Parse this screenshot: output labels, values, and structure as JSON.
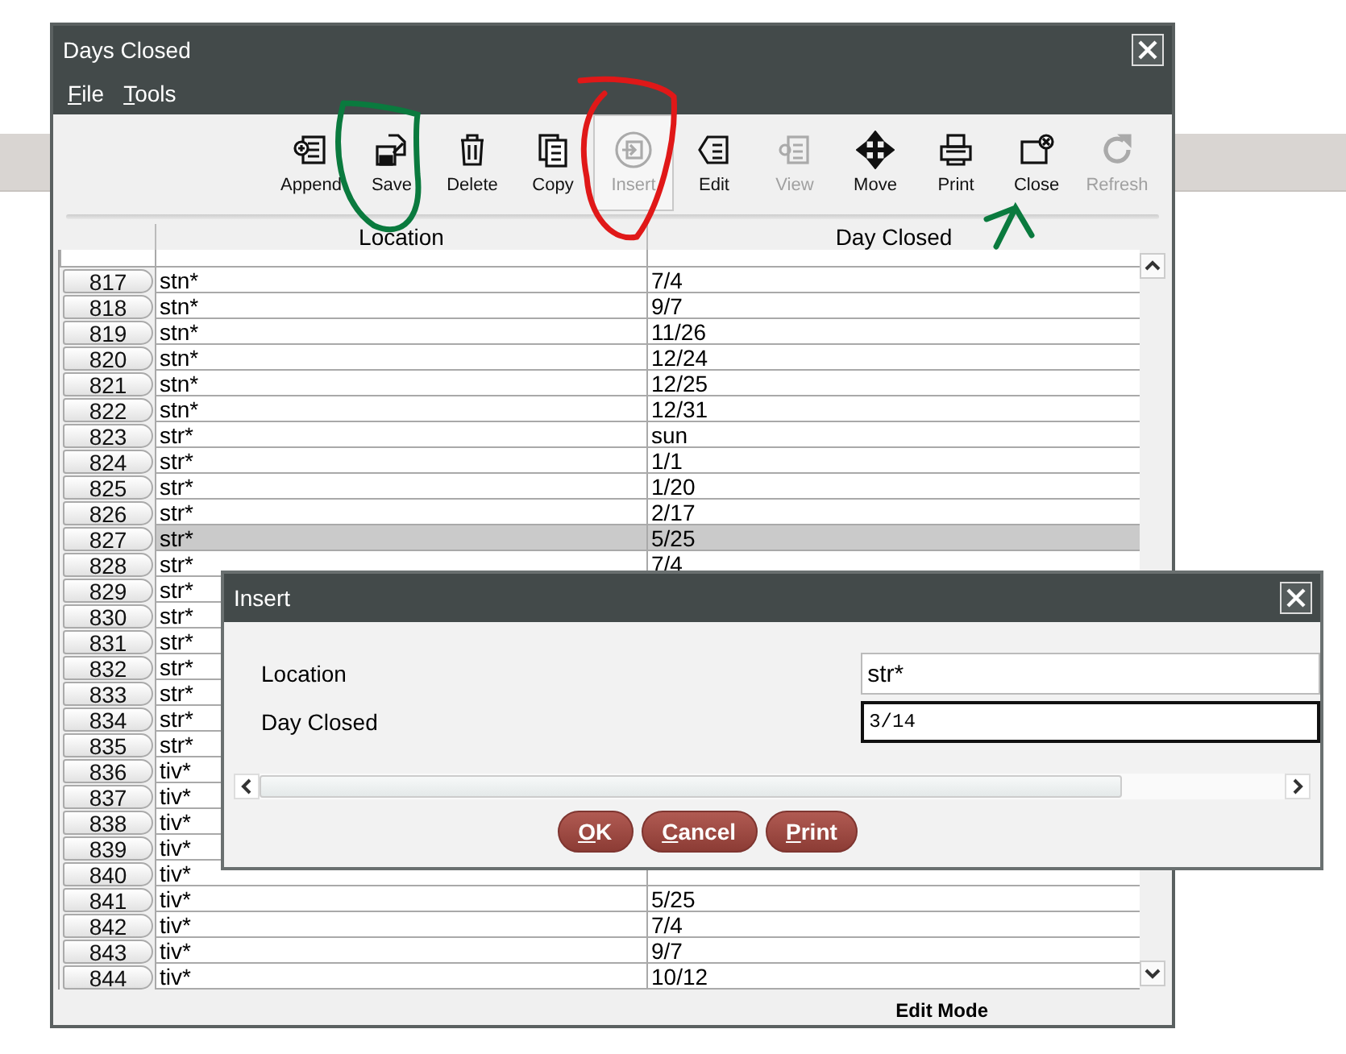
{
  "window": {
    "title": "Days Closed"
  },
  "menu": [
    {
      "label": "File",
      "mnemonic": true
    },
    {
      "label": "Tools",
      "mnemonic": true
    }
  ],
  "toolbar": [
    {
      "label": "Append",
      "disabled": false,
      "selected": false
    },
    {
      "label": "Save",
      "disabled": false,
      "selected": false
    },
    {
      "label": "Delete",
      "disabled": false,
      "selected": false
    },
    {
      "label": "Copy",
      "disabled": false,
      "selected": false
    },
    {
      "label": "Insert",
      "disabled": true,
      "selected": true
    },
    {
      "label": "Edit",
      "disabled": false,
      "selected": false
    },
    {
      "label": "View",
      "disabled": true,
      "selected": false
    },
    {
      "label": "Move",
      "disabled": false,
      "selected": false
    },
    {
      "label": "Print",
      "disabled": false,
      "selected": false
    },
    {
      "label": "Close",
      "disabled": false,
      "selected": false
    },
    {
      "label": "Refresh",
      "disabled": true,
      "selected": false
    }
  ],
  "table": {
    "columns": [
      "Location",
      "Day Closed"
    ],
    "rows": [
      {
        "number": "817",
        "location": "stn*",
        "day_closed": "7/4",
        "selected": false
      },
      {
        "number": "818",
        "location": "stn*",
        "day_closed": "9/7",
        "selected": false
      },
      {
        "number": "819",
        "location": "stn*",
        "day_closed": "11/26",
        "selected": false
      },
      {
        "number": "820",
        "location": "stn*",
        "day_closed": "12/24",
        "selected": false
      },
      {
        "number": "821",
        "location": "stn*",
        "day_closed": "12/25",
        "selected": false
      },
      {
        "number": "822",
        "location": "stn*",
        "day_closed": "12/31",
        "selected": false
      },
      {
        "number": "823",
        "location": "str*",
        "day_closed": "sun",
        "selected": false
      },
      {
        "number": "824",
        "location": "str*",
        "day_closed": "1/1",
        "selected": false
      },
      {
        "number": "825",
        "location": "str*",
        "day_closed": "1/20",
        "selected": false
      },
      {
        "number": "826",
        "location": "str*",
        "day_closed": "2/17",
        "selected": false
      },
      {
        "number": "827",
        "location": "str*",
        "day_closed": "5/25",
        "selected": true
      },
      {
        "number": "828",
        "location": "str*",
        "day_closed": "7/4",
        "selected": false
      },
      {
        "number": "829",
        "location": "str*",
        "selected": false
      },
      {
        "number": "830",
        "location": "str*",
        "selected": false
      },
      {
        "number": "831",
        "location": "str*",
        "selected": false
      },
      {
        "number": "832",
        "location": "str*",
        "selected": false
      },
      {
        "number": "833",
        "location": "str*",
        "selected": false
      },
      {
        "number": "834",
        "location": "str*",
        "selected": false
      },
      {
        "number": "835",
        "location": "str*",
        "selected": false
      },
      {
        "number": "836",
        "location": "tiv*",
        "selected": false
      },
      {
        "number": "837",
        "location": "tiv*",
        "selected": false
      },
      {
        "number": "838",
        "location": "tiv*",
        "selected": false
      },
      {
        "number": "839",
        "location": "tiv*",
        "selected": false
      },
      {
        "number": "840",
        "location": "tiv*",
        "selected": false
      },
      {
        "number": "841",
        "location": "tiv*",
        "day_closed": "5/25",
        "selected": false
      },
      {
        "number": "842",
        "location": "tiv*",
        "day_closed": "7/4",
        "selected": false
      },
      {
        "number": "843",
        "location": "tiv*",
        "day_closed": "9/7",
        "selected": false
      },
      {
        "number": "844",
        "location": "tiv*",
        "day_closed": "10/12",
        "selected": false
      }
    ]
  },
  "status_bar": "Edit Mode",
  "dialog": {
    "title": "Insert",
    "fields": [
      {
        "label": "Location",
        "value": "str*",
        "kind": "text"
      },
      {
        "label": "Day Closed",
        "value": "3/14",
        "kind": "mono"
      }
    ],
    "buttons": [
      {
        "label": "OK",
        "mnemonic": true
      },
      {
        "label": "Cancel",
        "mnemonic": true
      },
      {
        "label": "Print",
        "mnemonic": true
      }
    ]
  }
}
